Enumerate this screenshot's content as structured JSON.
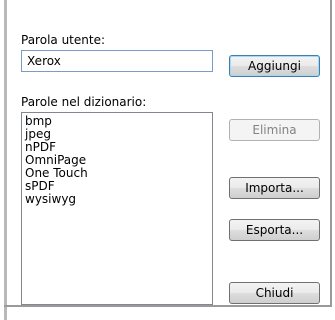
{
  "dialog": {
    "user_word_label": "Parola utente:",
    "user_word_value": "Xerox",
    "dictionary_label": "Parole nel dizionario:",
    "dictionary_items": [
      "bmp",
      "jpeg",
      "nPDF",
      "OmniPage",
      "One Touch",
      "sPDF",
      "wysiwyg"
    ],
    "buttons": {
      "add": "Aggiungi",
      "delete": "Elimina",
      "import": "Importa...",
      "export": "Esporta...",
      "close": "Chiudi"
    }
  }
}
